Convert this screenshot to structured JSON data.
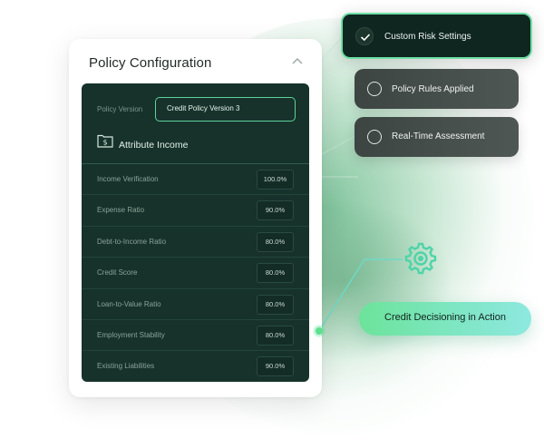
{
  "policy_card": {
    "title": "Policy Configuration",
    "version_label": "Policy Version",
    "version_value": "Credit Policy Version 3",
    "attribute_title": "Attribute Income",
    "rows": [
      {
        "label": "Income Verification",
        "value": "100.0%"
      },
      {
        "label": "Expense Ratio",
        "value": "90.0%"
      },
      {
        "label": "Debt-to-Income Ratio",
        "value": "80.0%"
      },
      {
        "label": "Credit Score",
        "value": "80.0%"
      },
      {
        "label": "Loan-to-Value Ratio",
        "value": "80.0%"
      },
      {
        "label": "Employment Stability",
        "value": "80.0%"
      },
      {
        "label": "Existing Liabilities",
        "value": "90.0%"
      }
    ]
  },
  "options": {
    "custom_risk": "Custom Risk Settings",
    "policy_rules": "Policy Rules Applied",
    "realtime": "Real-Time Assessment"
  },
  "cta": {
    "label": "Credit Decisioning in Action"
  },
  "icons": {
    "check": "check-icon",
    "chevron": "chevron-up-icon",
    "attribute": "dollar-folder-icon",
    "gear": "gear-icon"
  },
  "colors": {
    "panel_bg": "#16322b",
    "accent_green": "#5fd29a",
    "cta_start": "#6ce39a",
    "cta_end": "#8ee8df",
    "pill_dark_bg": "#0f2620"
  }
}
